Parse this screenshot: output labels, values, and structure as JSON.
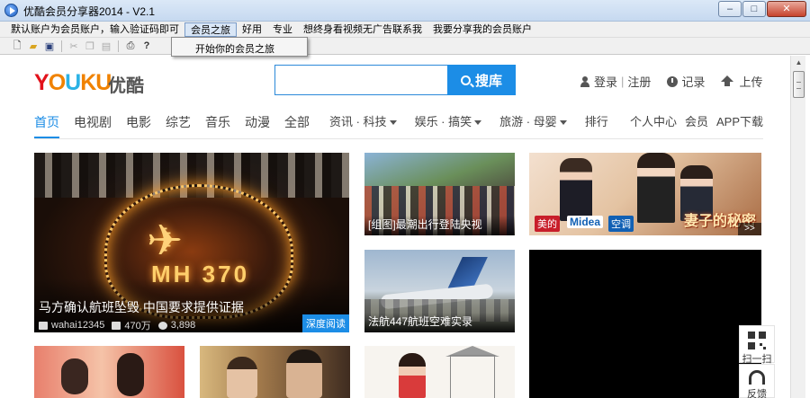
{
  "window": {
    "title": "优酷会员分享器2014 - V2.1",
    "buttons": {
      "minimize": "–",
      "maximize": "□",
      "close": "✕"
    }
  },
  "menubar": {
    "items": [
      "默认账户为会员账户，输入验证码即可",
      "会员之旅",
      "好用",
      "专业",
      "想终身看视频无广告联系我",
      "我要分享我的会员账户"
    ]
  },
  "dropdown": {
    "item": "开始你的会员之旅"
  },
  "toolbar": {
    "icons": [
      "new-file-icon",
      "open-folder-icon",
      "save-icon",
      "cut-icon",
      "copy-icon",
      "paste-icon",
      "print-icon",
      "help-icon"
    ]
  },
  "site": {
    "logo": {
      "y": "Y",
      "o": "O",
      "u": "U",
      "ku": "KU",
      "cn": "优酷"
    },
    "search": {
      "placeholder": "",
      "button": "搜库"
    },
    "user_links": {
      "login": "登录",
      "sep": "|",
      "register": "注册",
      "history": "记录",
      "upload": "上传"
    },
    "nav": {
      "items": [
        "首页",
        "电视剧",
        "电影",
        "综艺",
        "音乐",
        "动漫",
        "全部"
      ],
      "dropdowns": [
        "资讯 · 科技",
        "娱乐 · 搞笑",
        "旅游 · 母婴"
      ],
      "ranking": "排行",
      "right": [
        "个人中心",
        "会员",
        "APP下载"
      ]
    },
    "feature": {
      "plane_glyph": "✈",
      "mh": "MH 370",
      "caption": "马方确认航班坠毁 中国要求提供证据",
      "user": "wahai12345",
      "plays": "470万",
      "comments": "3,898",
      "badge": "深度阅读"
    },
    "tiles": [
      {
        "caption": "[组图]最潮出行登陆央视"
      },
      {
        "caption": "法航447航班空难实录"
      }
    ],
    "ad": {
      "brand1": "美的",
      "brand2": "Midea",
      "brand3": "空调",
      "drama": "妻子的秘密",
      "more": ">>"
    },
    "side_tools": {
      "scan": "扫一扫",
      "feedback": "反馈"
    }
  },
  "colors": {
    "brand_blue": "#1c8de6",
    "youku_red": "#e2121b",
    "youku_orange": "#f08200",
    "youku_cyan": "#2bb2e5"
  }
}
